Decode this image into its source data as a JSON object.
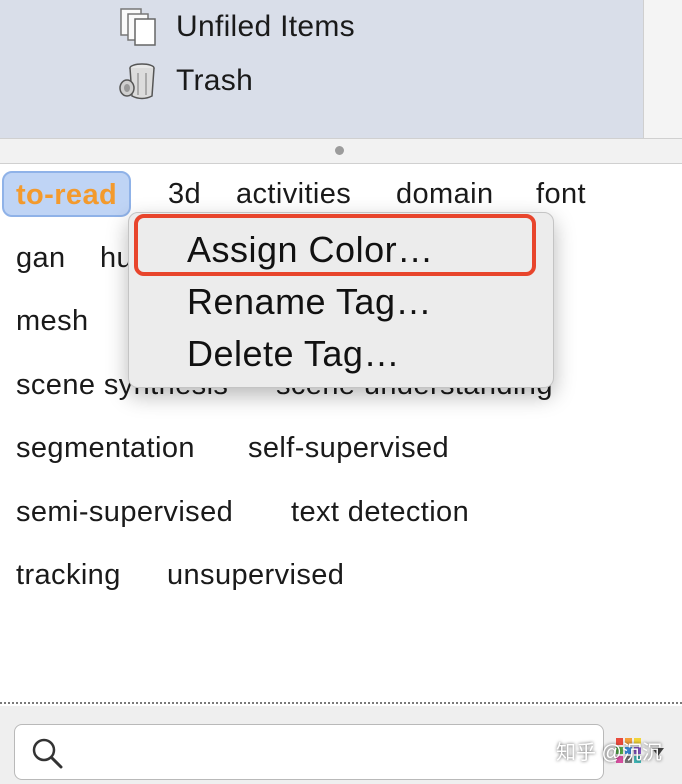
{
  "collections": {
    "items": [
      {
        "label": "Unfiled Items",
        "icon": "unfiled-items-icon"
      },
      {
        "label": "Trash",
        "icon": "trash-icon"
      }
    ]
  },
  "tags": {
    "selected": "to-read",
    "items": [
      "to-read",
      "3d",
      "activities",
      "domain",
      "font",
      "gan",
      "hu",
      "mesh",
      "scene synthesis",
      "scene understanding",
      "segmentation",
      "self-supervised",
      "semi-supervised",
      "text detection",
      "tracking",
      "unsupervised"
    ]
  },
  "context_menu": {
    "items": [
      "Assign Color…",
      "Rename Tag…",
      "Delete Tag…"
    ],
    "highlighted": "Assign Color…"
  },
  "search": {
    "value": "",
    "placeholder": ""
  },
  "watermark": "知乎 @沉沉",
  "colors": {
    "collections_bg": "#d9dee9",
    "selected_tag_text": "#f39a2d",
    "selected_tag_bg": "#bfd4f5",
    "highlight_border": "#e8452c",
    "menu_bg": "#ececec"
  }
}
